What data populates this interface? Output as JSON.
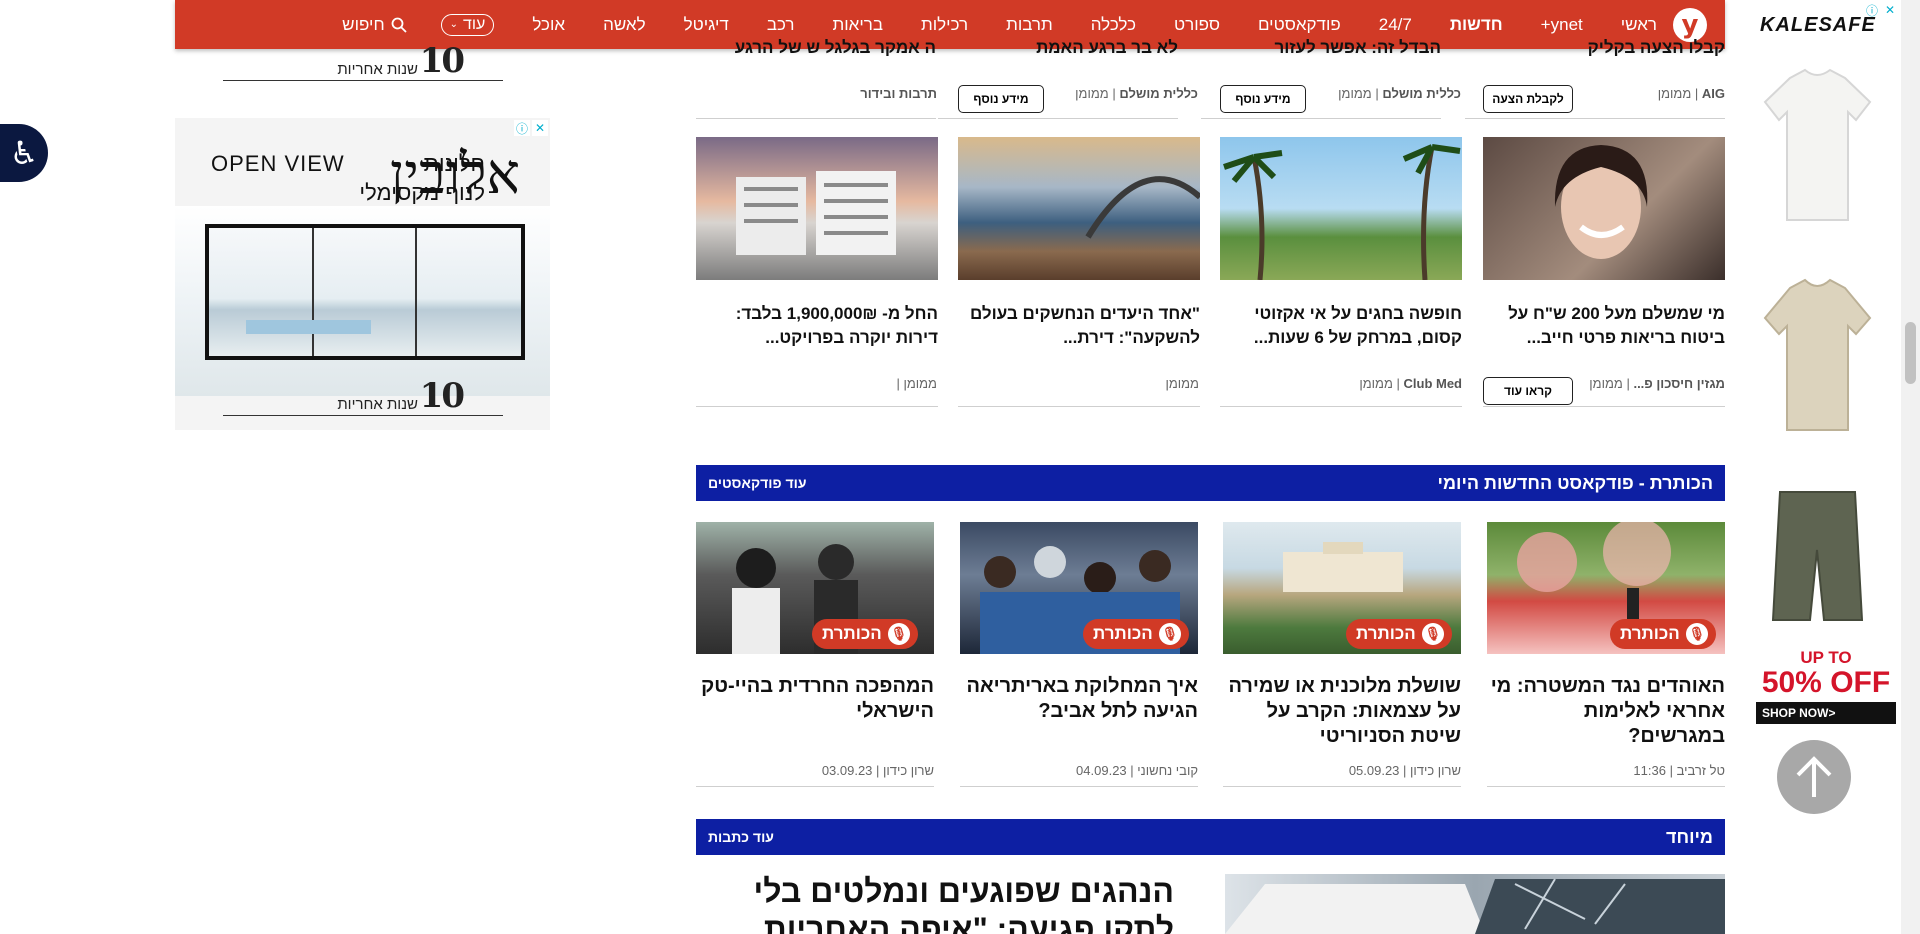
{
  "nav": {
    "logo": "y",
    "items": [
      "ראשי",
      "ynet+",
      "חדשות",
      "24/7",
      "פודקאסטים",
      "ספורט",
      "כלכלה",
      "תרבות",
      "רכילות",
      "בריאות",
      "רכב",
      "דיגיטל",
      "לאשה",
      "אוכל"
    ],
    "more_label": "עוד",
    "search_label": "חיפוש"
  },
  "ad_left": {
    "headline": "OPEN VIEW חלונות לנוף מקסימלי",
    "headline_en": "OPEN VIEW",
    "headline_he": "חלונות\nלנוף מקסימלי",
    "brand": "אלובין",
    "sig_text": "שנות אחריות",
    "sig_num": "10"
  },
  "ad_right": {
    "brand": "KALESAFE",
    "promo_line1": "UP TO",
    "promo_line2": "50% OFF",
    "shop": "SHOP NOW>"
  },
  "row1": {
    "partial_titles": [
      "קבלו הצעה בקליק",
      "הבדל זה: אפשר לעזור",
      "לא בר ברגע האמת",
      "ה אמקר בגלגל ש של הרגע"
    ],
    "metas": [
      {
        "source": "AIG",
        "label": "ממומן",
        "button": "לקבלת הצעה"
      },
      {
        "source": "כללית מושלם",
        "label": "ממומן",
        "button": "מידע נוסף"
      },
      {
        "source": "כללית מושלם",
        "label": "ממומן",
        "button": "מידע נוסף"
      },
      {
        "source": "תרבות ובידור",
        "label": "",
        "button": ""
      }
    ]
  },
  "cards": [
    {
      "title": "מי שמשלם מעל 200 ש\"ח על ביטוח בריאות פרטי חייב...",
      "source": "מגזין חיסכון פ...",
      "label": "ממומן",
      "button": "קראו עוד"
    },
    {
      "title": "חופשה בחגים על אי אקזוטי קסום, במרחק של 6 שעות...",
      "source": "Club Med",
      "label": "ממומן",
      "button": ""
    },
    {
      "title": "\"אחד היעדים הנחשקים בעולם להשקעה\": דירת...",
      "source": "",
      "label": "ממומן",
      "button": ""
    },
    {
      "title": "החל מ- 1,900,000₪ בלבד: דירות יוקרה בפרויקט...",
      "source": "",
      "label": "ממומן",
      "button": ""
    }
  ],
  "podcast_section": {
    "title": "הכותרת - פודקאסט החדשות היומי",
    "more": "עוד פודקאסטים",
    "badge": "הכותרת",
    "items": [
      {
        "title": "האוהדים נגד המשטרה: מי אחראי לאלימות במגרשים?",
        "author": "טל זרביב",
        "date": "11:36"
      },
      {
        "title": "שושלת מלוכנית או שמירה על עצמאות: הקרב על שיטת הסניוריטי",
        "author": "שרון כידון",
        "date": "05.09.23"
      },
      {
        "title": "איך המחלוקת באריתריאה הגיעה לתל אביב?",
        "author": "קובי נחשוני",
        "date": "04.09.23"
      },
      {
        "title": "המהפכה החרדית בהיי-טק הישראלי",
        "author": "שרון כידון",
        "date": "03.09.23"
      }
    ]
  },
  "special_section": {
    "title": "מיוחד",
    "more": "עוד כתבות",
    "feature_title": "הנהגים שפוגעים ונמלטים בלי לתקן פגיעה: \"איפה האחריות"
  },
  "colors": {
    "nav_red": "#d13a26",
    "section_blue": "#0d1fa3",
    "a11y_navy": "#0b1840"
  }
}
